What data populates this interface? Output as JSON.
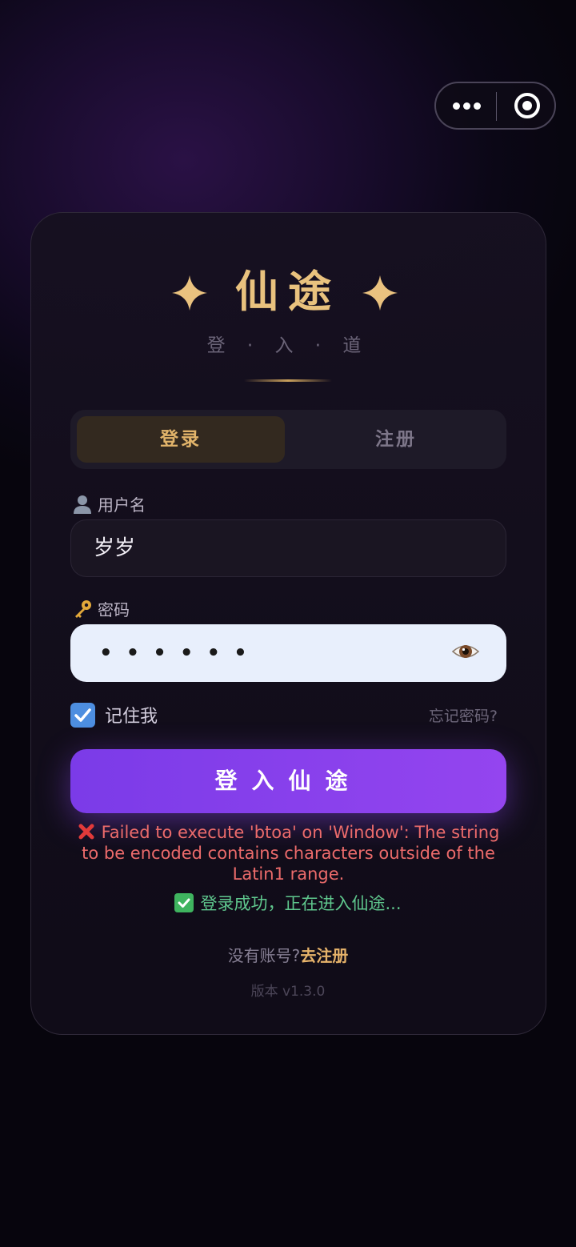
{
  "capsule": {
    "more_icon": "more-dots-icon",
    "close_icon": "target-close-icon"
  },
  "header": {
    "title": "仙途",
    "subtitle": "登 · 入 · 道",
    "title_color": "#e9c27e"
  },
  "tabs": [
    {
      "label": "登录",
      "active": true
    },
    {
      "label": "注册",
      "active": false
    }
  ],
  "form": {
    "username_label": "用户名",
    "username_icon": "user-icon",
    "username_value": "岁岁",
    "password_label": "密码",
    "password_icon": "key-icon",
    "password_value_masked": "••••••",
    "password_toggle_icon": "eye-icon",
    "remember_label": "记住我",
    "remember_checked": true,
    "forgot_label": "忘记密码?",
    "submit_label": "登入仙途"
  },
  "messages": {
    "error": "Failed to execute 'btoa' on 'Window': The string to be encoded contains characters outside of the Latin1 range.",
    "error_icon": "red-x-icon",
    "success": "登录成功，正在进入仙途...",
    "success_icon": "green-check-icon"
  },
  "footer": {
    "no_account": "没有账号?",
    "register_link": "去注册",
    "version": "版本 v1.3.0"
  },
  "colors": {
    "accent_gold": "#e2b46a",
    "button_purple": "#8a40ec",
    "error_red": "#ec6b6b",
    "success_green": "#5fc88e"
  }
}
